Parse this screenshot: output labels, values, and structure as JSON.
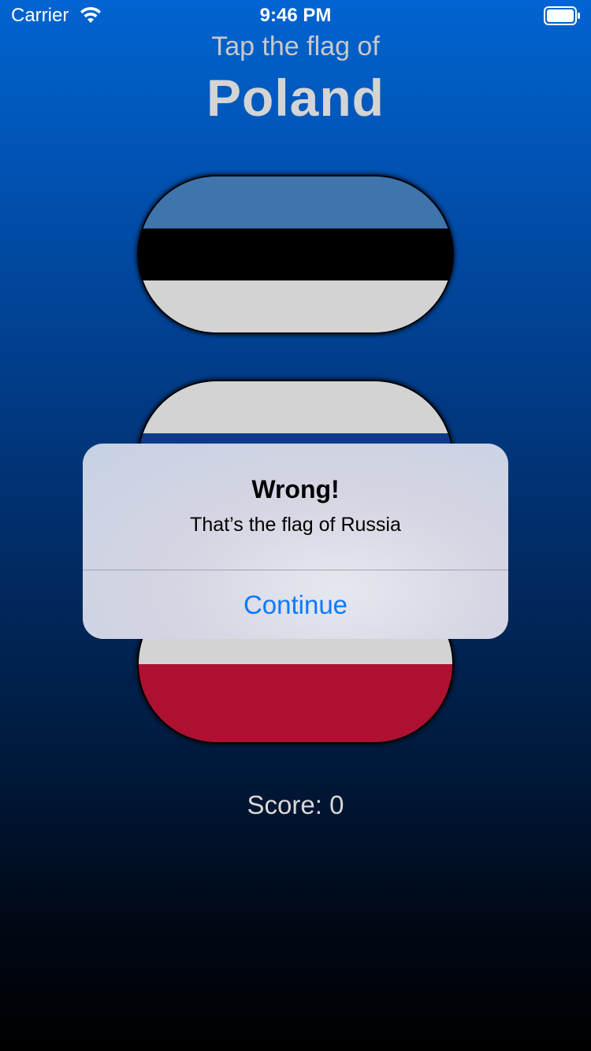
{
  "status_bar": {
    "carrier": "Carrier",
    "time": "9:46 PM",
    "wifi_icon": "wifi-icon",
    "battery_icon": "battery-icon"
  },
  "header": {
    "prompt": "Tap the flag of",
    "country": "Poland"
  },
  "flags": [
    {
      "name": "estonia-flag",
      "stripes": [
        "#3f74ac",
        "#000000",
        "#d3d3d3"
      ]
    },
    {
      "name": "russia-flag",
      "stripes": [
        "#d3d3d3",
        "#0e3a8c",
        "#c0243a"
      ]
    },
    {
      "name": "poland-flag",
      "stripes": [
        "#d3d3d3",
        "#ad1030"
      ]
    }
  ],
  "score": {
    "text": "Score: 0"
  },
  "alert": {
    "title": "Wrong!",
    "message": "That’s the flag of Russia",
    "button_label": "Continue",
    "button_color": "#0a7aff"
  },
  "colors": {
    "background_top": "#0164d1",
    "background_bottom": "#000000"
  }
}
